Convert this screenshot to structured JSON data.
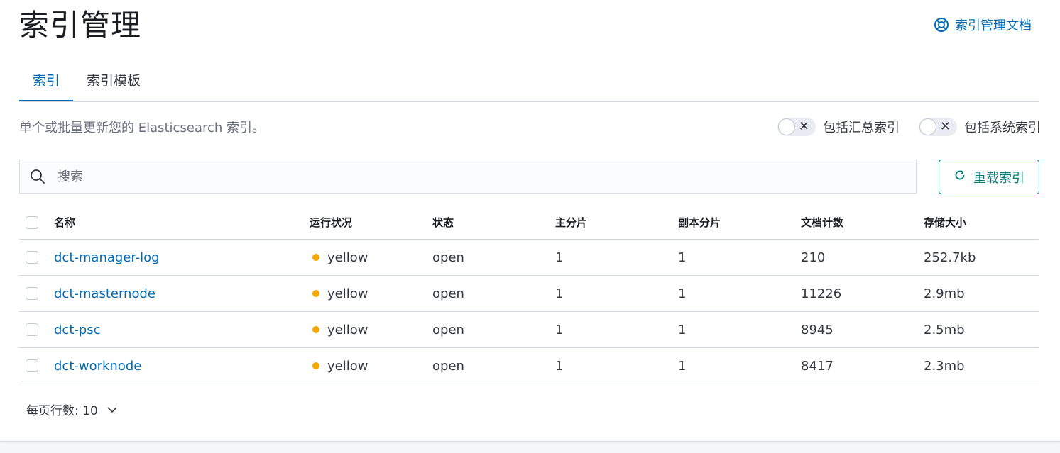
{
  "page": {
    "title": "索引管理",
    "doc_link_label": "索引管理文档"
  },
  "tabs": [
    {
      "label": "索引",
      "active": true
    },
    {
      "label": "索引模板",
      "active": false
    }
  ],
  "description": "单个或批量更新您的 Elasticsearch 索引。",
  "toggles": [
    {
      "label": "包括汇总索引",
      "on": false
    },
    {
      "label": "包括系统索引",
      "on": false
    }
  ],
  "search": {
    "placeholder": "搜索",
    "value": ""
  },
  "reload_button_label": "重载索引",
  "table": {
    "columns": [
      "名称",
      "运行状况",
      "状态",
      "主分片",
      "副本分片",
      "文档计数",
      "存储大小"
    ],
    "rows": [
      {
        "name": "dct-manager-log",
        "health": "yellow",
        "status": "open",
        "primary": "1",
        "replicas": "1",
        "docs": "210",
        "size": "252.7kb"
      },
      {
        "name": "dct-masternode",
        "health": "yellow",
        "status": "open",
        "primary": "1",
        "replicas": "1",
        "docs": "11226",
        "size": "2.9mb"
      },
      {
        "name": "dct-psc",
        "health": "yellow",
        "status": "open",
        "primary": "1",
        "replicas": "1",
        "docs": "8945",
        "size": "2.5mb"
      },
      {
        "name": "dct-worknode",
        "health": "yellow",
        "status": "open",
        "primary": "1",
        "replicas": "1",
        "docs": "8417",
        "size": "2.3mb"
      }
    ]
  },
  "pagination": {
    "rows_per_page_label": "每页行数: 10"
  },
  "colors": {
    "accent": "#006bb4",
    "success": "#017d73",
    "health_yellow": "#f5a700"
  },
  "icons": {
    "doc_link": "help-lifebuoy-icon",
    "search": "search-icon",
    "reload": "refresh-icon",
    "pager": "chevron-down-icon",
    "toggle_off": "cross-icon"
  }
}
